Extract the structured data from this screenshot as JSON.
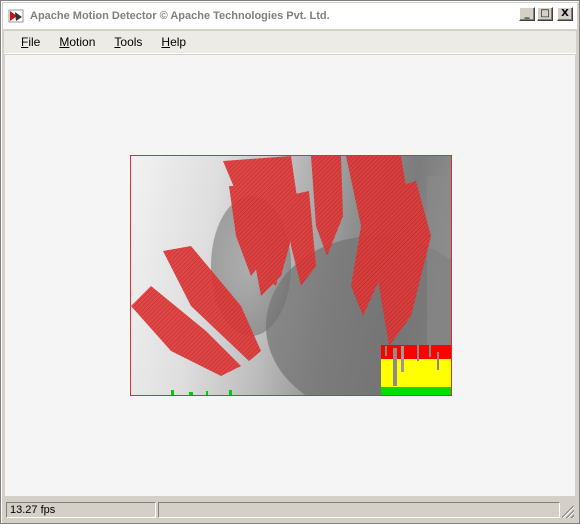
{
  "window": {
    "title": "Apache Motion Detector © Apache Technologies Pvt. Ltd.",
    "controls": {
      "minimize": "_",
      "maximize": "□",
      "close": "X"
    }
  },
  "menu": [
    {
      "label": "File",
      "accel": "F"
    },
    {
      "label": "Motion",
      "accel": "M"
    },
    {
      "label": "Tools",
      "accel": "T"
    },
    {
      "label": "Help",
      "accel": "H"
    }
  ],
  "video": {
    "motion_overlay_color": "#e03030",
    "meter_colors": {
      "high": "#ff0000",
      "medium": "#ffff00",
      "low": "#00e000"
    }
  },
  "status": {
    "fps": "13.27 fps",
    "message": ""
  }
}
